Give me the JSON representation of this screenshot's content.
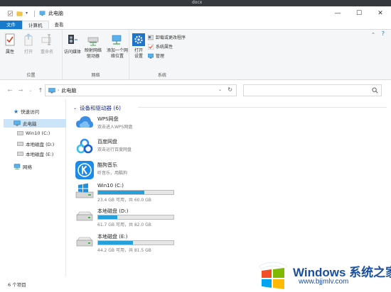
{
  "window_title_strip": "docx",
  "titlebar": {
    "title": "此电脑",
    "minimize": "—",
    "maximize": "☐",
    "close": "✕"
  },
  "tabs": [
    {
      "label": "文件"
    },
    {
      "label": "计算机"
    },
    {
      "label": "查看"
    }
  ],
  "ribbon": {
    "location": {
      "label": "位置",
      "buttons": [
        {
          "label": "属性"
        },
        {
          "label": "打开"
        },
        {
          "label": "重命名"
        }
      ]
    },
    "network": {
      "label": "网络",
      "buttons": [
        {
          "label": "访问媒体"
        },
        {
          "label": "映射网络驱动器"
        },
        {
          "label": "添加一个网络位置"
        }
      ]
    },
    "system": {
      "label": "系统",
      "open_settings": "打开设置",
      "items": [
        {
          "label": "卸载或更改程序"
        },
        {
          "label": "系统属性"
        },
        {
          "label": "管理"
        }
      ]
    }
  },
  "address": {
    "path": "此电脑",
    "search_placeholder": ""
  },
  "nav_pane": {
    "items": [
      {
        "label": "快速访问",
        "icon": "star-icon"
      },
      {
        "label": "此电脑",
        "icon": "computer-icon",
        "selected": true
      },
      {
        "label": "Win10 (C:)",
        "icon": "drive-icon"
      },
      {
        "label": "本地磁盘 (D:)",
        "icon": "drive-icon"
      },
      {
        "label": "本地磁盘 (E:)",
        "icon": "drive-icon"
      },
      {
        "label": "网络",
        "icon": "network-icon"
      }
    ]
  },
  "content": {
    "section_title": "设备和驱动器 (6)",
    "apps": [
      {
        "name": "WPS网盘",
        "sub": "双击进入WPS网盘",
        "icon": "cloud-icon"
      },
      {
        "name": "百度网盘",
        "sub": "双击运行百度网盘",
        "icon": "baidu-netdisk-icon"
      },
      {
        "name": "酷狗音乐",
        "sub": "听音乐，用酷狗",
        "icon": "kugou-icon"
      }
    ],
    "drives": [
      {
        "name": "Win10 (C:)",
        "info": "23.4 GB 可用，共 60.0 GB",
        "used_fraction": 0.61,
        "icon": "windows-drive-icon"
      },
      {
        "name": "本地磁盘 (D:)",
        "info": "61.7 GB 可用，共 82.0 GB",
        "used_fraction": 0.25,
        "icon": "drive-icon"
      },
      {
        "name": "本地磁盘 (E:)",
        "info": "44.2 GB 可用，共 81.5 GB",
        "used_fraction": 0.46,
        "icon": "drive-icon"
      }
    ]
  },
  "status": {
    "item_count": "6 个项目"
  },
  "watermark": {
    "title": "Windows 系统之家",
    "url": "www.bjjmlv.com"
  },
  "colors": {
    "accent": "#1979ca",
    "bar_fill": "#26a0da",
    "section_title": "#1e3287"
  }
}
